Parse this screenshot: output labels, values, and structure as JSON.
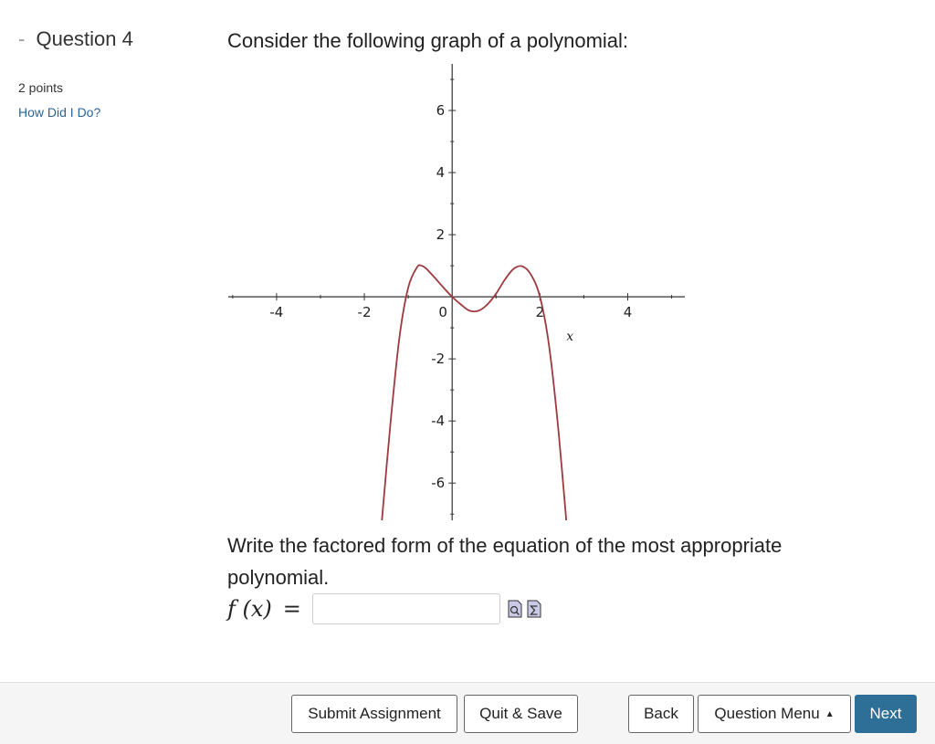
{
  "question": {
    "dash": "-",
    "title": "Question 4",
    "points": "2 points",
    "help_link": "How Did I Do?"
  },
  "prompt": "Consider the following graph of a polynomial:",
  "chart_data": {
    "type": "line",
    "xlabel": "x",
    "xlim": [
      -5.1,
      5.3
    ],
    "ylim": [
      -7.2,
      7.5
    ],
    "x_ticks": [
      -4,
      -2,
      0,
      2,
      4
    ],
    "y_ticks": [
      -6,
      -4,
      -2,
      2,
      4,
      6
    ],
    "x_tick_labels": [
      "-4",
      "-2",
      "0",
      "2",
      "4"
    ],
    "y_tick_labels": [
      "-6",
      "-4",
      "-2",
      "2",
      "4",
      "6"
    ],
    "curve_color": "#9e3a3f",
    "series": [
      {
        "x": [
          -1.6,
          -1.4,
          -1.2,
          -1.0,
          -0.8,
          -0.7,
          -0.6,
          -0.4,
          -0.2,
          0.0,
          0.2,
          0.4,
          0.6,
          0.8,
          1.0,
          1.2,
          1.4,
          1.6,
          1.8,
          2.0,
          2.2,
          2.4,
          2.6
        ],
        "y": [
          -7.2,
          -4.0,
          -1.3,
          0.3,
          0.95,
          1.0,
          0.92,
          0.62,
          0.3,
          0.0,
          -0.25,
          -0.45,
          -0.45,
          -0.25,
          0.1,
          0.55,
          0.9,
          0.98,
          0.7,
          0.0,
          -1.5,
          -4.0,
          -7.2
        ]
      }
    ]
  },
  "instruction": "Write the factored form of the equation of the most appropriate polynomial.",
  "answer": {
    "lhs": "f (x)",
    "equals": "=",
    "value": "",
    "placeholder": ""
  },
  "footer": {
    "submit": "Submit Assignment",
    "quit": "Quit & Save",
    "back": "Back",
    "menu": "Question Menu",
    "menu_caret": "▲",
    "next": "Next"
  },
  "colors": {
    "link": "#2a6496",
    "next_button": "#2d6f96",
    "curve": "#9e3a3f"
  }
}
